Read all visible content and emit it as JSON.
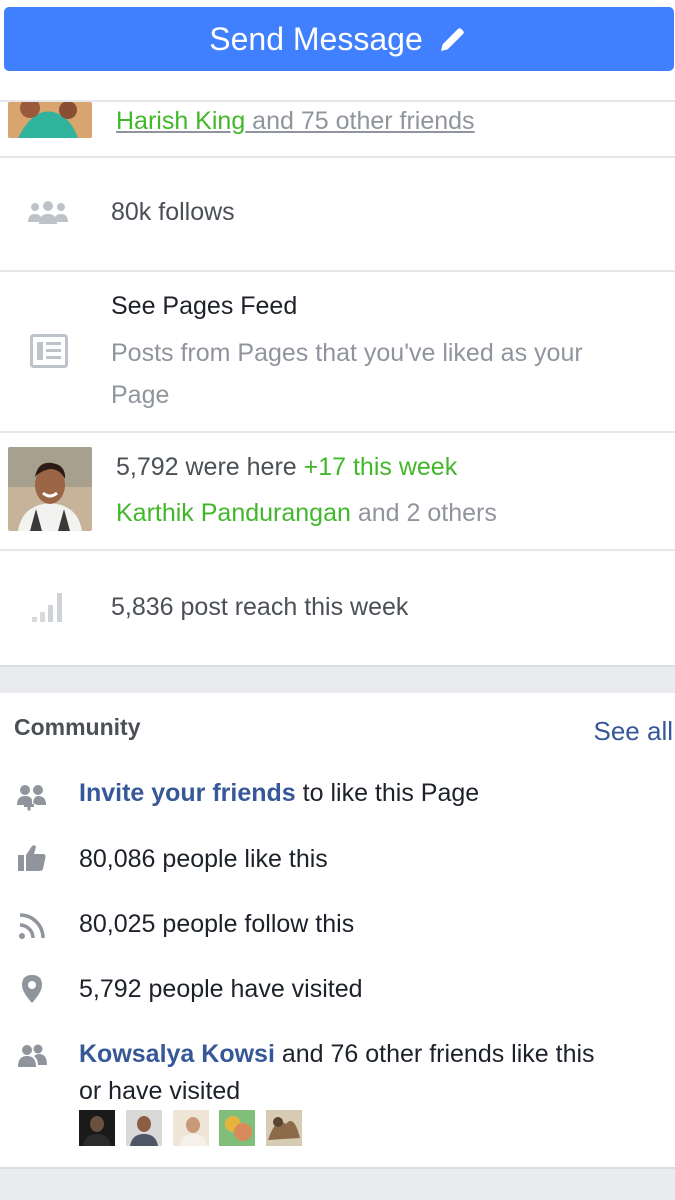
{
  "header": {
    "send_label": "Send Message"
  },
  "friends_row": {
    "name": "Harish King",
    "rest": " and 75 other friends"
  },
  "follows_row": {
    "text": "80k follows"
  },
  "pages_feed": {
    "title": "See Pages Feed",
    "subtitle_line1": "Posts from Pages that you've liked as your",
    "subtitle_line2": "Page"
  },
  "checkins_row": {
    "count_text": "5,792 were here ",
    "week_text": "+17 this week",
    "name": "Karthik Pandurangan",
    "others": " and 2 others"
  },
  "reach_row": {
    "text": "5,836 post reach this week"
  },
  "community": {
    "title": "Community",
    "see_all": "See all",
    "invite_link": "Invite your friends",
    "invite_rest": " to like this Page",
    "likes": "80,086 people like this",
    "follows": "80,025 people follow this",
    "visited": "5,792 people have visited",
    "friend_name": "Kowsalya Kowsi",
    "friend_rest_line1": " and 76 other friends like this",
    "friend_rest_line2": "or have visited"
  },
  "icons": {
    "people": "people-icon",
    "feed": "feed-icon",
    "reach": "signal-bars-icon",
    "invite": "add-friend-icon",
    "like": "thumbs-up-icon",
    "rss": "rss-icon",
    "pin": "location-pin-icon",
    "friends": "friends-icon"
  },
  "colors": {
    "primary": "#4080ff",
    "green": "#42b72a",
    "link_blue": "#365899",
    "gray": "#90949c"
  }
}
